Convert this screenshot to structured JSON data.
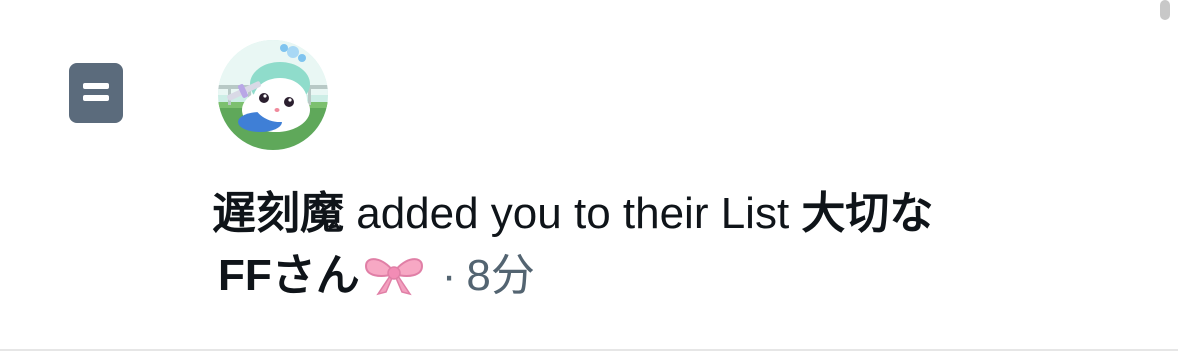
{
  "notification": {
    "type_icon": "list-icon",
    "avatar_icon": "avatar-character-icon",
    "actor_name": "遅刻魔",
    "action_text": " added you to their List ",
    "list_name_part1": "大切な",
    "list_name_part2": "FFさん",
    "list_emoji_icon": "ribbon-bow-icon",
    "separator": "·",
    "timestamp": "8分"
  },
  "colors": {
    "icon_bg": "#5b6b7c",
    "text_primary": "#0f1419",
    "text_secondary": "#536471",
    "bow_pink": "#f7a8c4"
  }
}
